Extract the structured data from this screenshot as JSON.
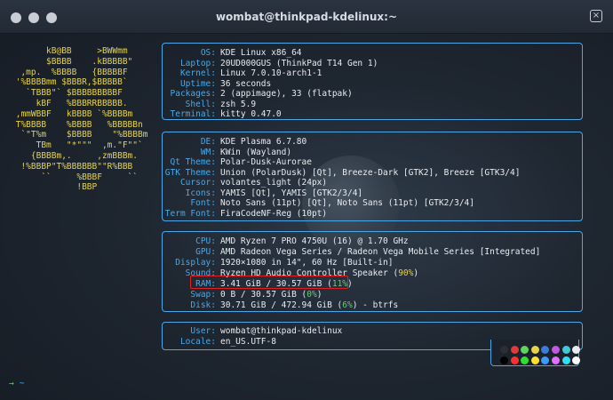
{
  "window": {
    "title": "wombat@thinkpad-kdelinux:~",
    "close_glyph": "×"
  },
  "logo_lines": [
    "       kB@BB     >BWWmm",
    "       $BBBB    .kBBBBB\"",
    "  ,mp.  %BBBB   {BBBBBF",
    " '%BBBBmm $BBBR,$BBBBB`",
    "   `TBBB\"` $BBBBBBBBBF",
    "     kBF   %BBBRRBBBBB.",
    " ,mmWBBF   kBBBB `%BBBBm",
    " T%BBBB    %BBBB   %BBBBBn",
    "  `\"T%m    $BBBB    \"%BBBBm",
    "     TBm   \"*\"\"\"  ,m.\"F\"\"`",
    "    {BBBBm,.     ,zmBBBm.",
    "  !%BBBP\"T%BBBBBB\"\"R%BBB",
    "      ``     %BBBF     ``",
    "             !BBP"
  ],
  "system": [
    {
      "key": "OS:",
      "value": "KDE Linux x86_64"
    },
    {
      "key": "Laptop:",
      "value": "20UD000GUS (ThinkPad T14 Gen 1)"
    },
    {
      "key": "Kernel:",
      "value": "Linux 7.0.10-arch1-1"
    },
    {
      "key": "Uptime:",
      "value": "36 seconds"
    },
    {
      "key": "Packages:",
      "value": "2 (appimage), 33 (flatpak)"
    },
    {
      "key": "Shell:",
      "value": "zsh 5.9"
    },
    {
      "key": "Terminal:",
      "value": "kitty 0.47.0"
    }
  ],
  "desktop": [
    {
      "key": "DE:",
      "value": "KDE Plasma 6.7.80"
    },
    {
      "key": "WM:",
      "value": "KWin (Wayland)"
    },
    {
      "key": "Qt Theme:",
      "value": "Polar-Dusk-Aurorae"
    },
    {
      "key": "GTK Theme:",
      "value": "Union (PolarDusk) [Qt], Breeze-Dark [GTK2], Breeze [GTK3/4]"
    },
    {
      "key": "Cursor:",
      "value": "volantes_light (24px)"
    },
    {
      "key": "Icons:",
      "value": "YAMIS [Qt], YAMIS [GTK2/3/4]"
    },
    {
      "key": "Font:",
      "value": "Noto Sans (11pt) [Qt], Noto Sans (11pt) [GTK2/3/4]"
    },
    {
      "key": "Term Font:",
      "value": "FiraCodeNF-Reg (10pt)"
    }
  ],
  "hardware": {
    "cpu": {
      "key": "CPU:",
      "value": "AMD Ryzen 7 PRO 4750U (16) @ 1.70 GHz"
    },
    "gpu": {
      "key": "GPU:",
      "value": "AMD Radeon Vega Series / Radeon Vega Mobile Series [Integrated]"
    },
    "display": {
      "key": "Display:",
      "value": "1920×1080 in 14\", 60 Hz [Built-in]"
    },
    "sound": {
      "key": "Sound:",
      "value": "Ryzen HD Audio Controller Speaker (",
      "pct": "90%",
      "end": ")"
    },
    "ram": {
      "key": "RAM:",
      "value": "3.41 GiB / 30.57 GiB (",
      "pct": "11%",
      "end": ")"
    },
    "swap": {
      "key": "Swap:",
      "value": "0 B / 30.57 GiB (",
      "pct": "0%",
      "end": ")"
    },
    "disk": {
      "key": "Disk:",
      "value": "30.71 GiB / 472.94 GiB (",
      "pct": "6%",
      "end": ") - btrfs"
    }
  },
  "user": [
    {
      "key": "User:",
      "value": "wombat@thinkpad-kdelinux"
    },
    {
      "key": "Locale:",
      "value": "en_US.UTF-8"
    }
  ],
  "palette_row1": [
    "#2a2f36",
    "#e03b3b",
    "#5fd35f",
    "#e6d34a",
    "#3a7be0",
    "#c05ae0",
    "#3fc8d8",
    "#e8ecf1"
  ],
  "palette_row2": [
    "#000000",
    "#ff3030",
    "#30e030",
    "#ffe030",
    "#3a9bff",
    "#e070ff",
    "#30e0f0",
    "#ffffff"
  ],
  "prompt": {
    "arrow": "→",
    "dir": "~"
  }
}
